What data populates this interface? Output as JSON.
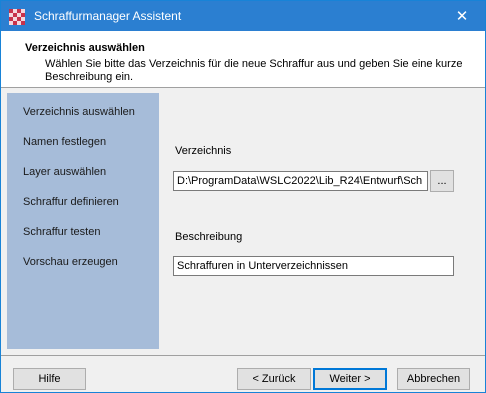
{
  "window": {
    "title": "Schraffurmanager Assistent",
    "close_glyph": "✕"
  },
  "header": {
    "title": "Verzeichnis auswählen",
    "description": "Wählen Sie bitte das Verzeichnis für die neue Schraffur aus und geben Sie eine kurze Beschreibung ein."
  },
  "steps": [
    {
      "label": "Verzeichnis auswählen"
    },
    {
      "label": "Namen festlegen"
    },
    {
      "label": "Layer auswählen"
    },
    {
      "label": "Schraffur definieren"
    },
    {
      "label": "Schraffur testen"
    },
    {
      "label": "Vorschau erzeugen"
    }
  ],
  "form": {
    "directory_label": "Verzeichnis",
    "directory_value": "D:\\ProgramData\\WSLC2022\\Lib_R24\\Entwurf\\Sch",
    "browse_label": "...",
    "description_label": "Beschreibung",
    "description_value": "Schraffuren in Unterverzeichnissen"
  },
  "buttons": {
    "help": "Hilfe",
    "back": "< Zurück",
    "next": "Weiter >",
    "cancel": "Abbrechen"
  },
  "colors": {
    "titlebar": "#2b7fd1",
    "sidebar": "#a6bcd9",
    "accent": "#0078d7"
  }
}
